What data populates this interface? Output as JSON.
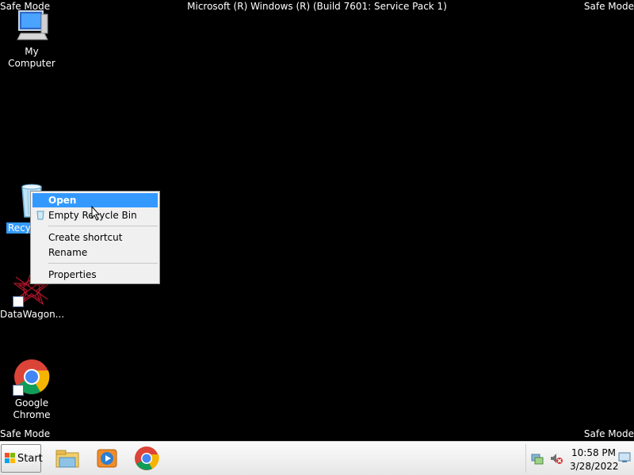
{
  "overlay": {
    "safe_mode": "Safe Mode",
    "top_center": "Microsoft (R) Windows (R) (Build 7601: Service Pack 1)"
  },
  "desktop": {
    "icons": [
      {
        "name": "my-computer",
        "label": "My Computer",
        "icon": "computer-icon"
      },
      {
        "name": "recycle-bin",
        "label": "Recyc",
        "icon": "recycle-bin-icon"
      },
      {
        "name": "datawagon",
        "label": "DataWagon...",
        "icon": "datawagon-icon"
      },
      {
        "name": "google-chrome",
        "label_line1": "Google",
        "label_line2": "Chrome",
        "icon": "chrome-icon"
      }
    ]
  },
  "context_menu": {
    "items": [
      "Open",
      "Empty Recycle Bin",
      "Create shortcut",
      "Rename",
      "Properties"
    ],
    "highlighted": "Open"
  },
  "taskbar": {
    "start_label": "Start",
    "pinned": [
      "file-explorer-icon",
      "media-player-icon",
      "chrome-icon"
    ],
    "tray_icons": [
      "network-icon",
      "volume-muted-icon",
      "show-desktop-icon"
    ],
    "time": "10:58 PM",
    "date": "3/28/2022"
  },
  "colors": {
    "desktop_bg": "#000000",
    "selection": "#3399ff",
    "taskbar_bg": "#f0f0f0"
  }
}
